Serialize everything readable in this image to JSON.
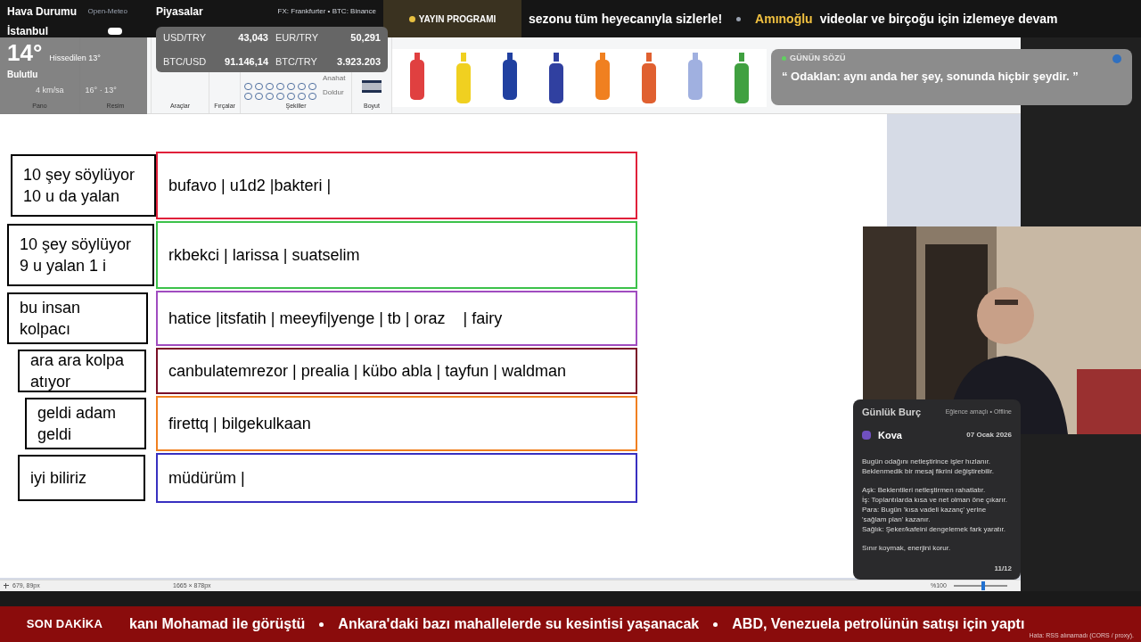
{
  "weather": {
    "title": "Hava Durumu",
    "source": "Open-Meteo",
    "city": "İstanbul",
    "temperature": "14°",
    "feels_like": "Hissedilen 13°",
    "condition": "Bulutlu",
    "wind": "4 km/sa",
    "range": "16° · 13°"
  },
  "markets": {
    "title": "Piyasalar",
    "source": "FX: Frankfurter • BTC: Binance",
    "rates": [
      {
        "pair": "USD/TRY",
        "value": "43,043"
      },
      {
        "pair": "EUR/TRY",
        "value": "50,291"
      },
      {
        "pair": "BTC/USD",
        "value": "91.146,14"
      },
      {
        "pair": "BTC/TRY",
        "value": "3.923.203"
      }
    ]
  },
  "schedule": {
    "label": "YAYIN PROGRAMI",
    "ticker": [
      {
        "text": "sezonu tüm heyecanıyla sizlerle!",
        "highlight": false
      },
      {
        "text": "Amınoğlu",
        "highlight": true
      },
      {
        "text": "videolar ve birçoğu için izlemeye devam",
        "highlight": false
      }
    ]
  },
  "ribbon": {
    "groups": [
      "Pano",
      "Resim",
      "Araçlar",
      "Fırçalar",
      "Şekiller",
      "Boyut"
    ],
    "options": [
      "Anahat",
      "Doldur"
    ]
  },
  "quote": {
    "title": "GÜNÜN SÖZÜ",
    "text": "“ Odaklan: aynı anda her şey, sonunda hiçbir şeydir. ”"
  },
  "board": [
    {
      "label": "10 şey söylüyor\n10 u da yalan",
      "names": "bufavo | u1d2 |bakteri |",
      "color": "#e0203a"
    },
    {
      "label": "10 şey söylüyor\n9 u yalan 1 i",
      "names": "rkbekci | larissa | suatselim",
      "color": "#3cc24a"
    },
    {
      "label": "bu insan\nkolpacı",
      "names": "hatice |itsfatih | meeyfi|yenge | tb | oraz    | fairy",
      "color": "#a04cc0"
    },
    {
      "label": "ara ara kolpa\natıyor",
      "names": "canbulatemrezor | prealia | kübo abla | tayfun | waldman",
      "color": "#7a1028"
    },
    {
      "label": "geldi adam\ngeldi",
      "names": "firettq | bilgekulkaan",
      "color": "#f08020"
    },
    {
      "label": "iyi biliriz",
      "names": "müdürüm |",
      "color": "#3830c0"
    }
  ],
  "horoscope": {
    "title": "Günlük Burç",
    "status": "Eğlence amaçlı • Offline",
    "sign": "Kova",
    "date": "07 Ocak 2026",
    "summary": "Bugün odağını netleştirince işler hızlanır. Beklenmedik bir mesaj fikrini değiştirebilir.",
    "lines": [
      "Aşk: Beklentileri netleştirmen rahatlatır.",
      "İş: Toplantılarda kısa ve net olman öne çıkarır.",
      "Para: Bugün 'kısa vadeli kazanç' yerine 'sağlam plan' kazanır.",
      "Sağlık: Şeker/kafeini dengelemek fark yaratır."
    ],
    "closing": "Sınır koymak, enerjini korur.",
    "page": "11/12"
  },
  "status_bar": {
    "cursor": "679, 89px",
    "size": "1665 × 878px",
    "zoom": "%100",
    "level": 0.55
  },
  "news": {
    "label": "SON DAKİKA",
    "items": [
      "kanı Mohamad ile görüştü",
      "Ankara'daki bazı mahallelerde su kesintisi yaşanacak",
      "ABD, Venezuela petrolünün satışı için yaptı"
    ],
    "error": "Hata: RSS alınamadı (CORS / proxy)."
  }
}
